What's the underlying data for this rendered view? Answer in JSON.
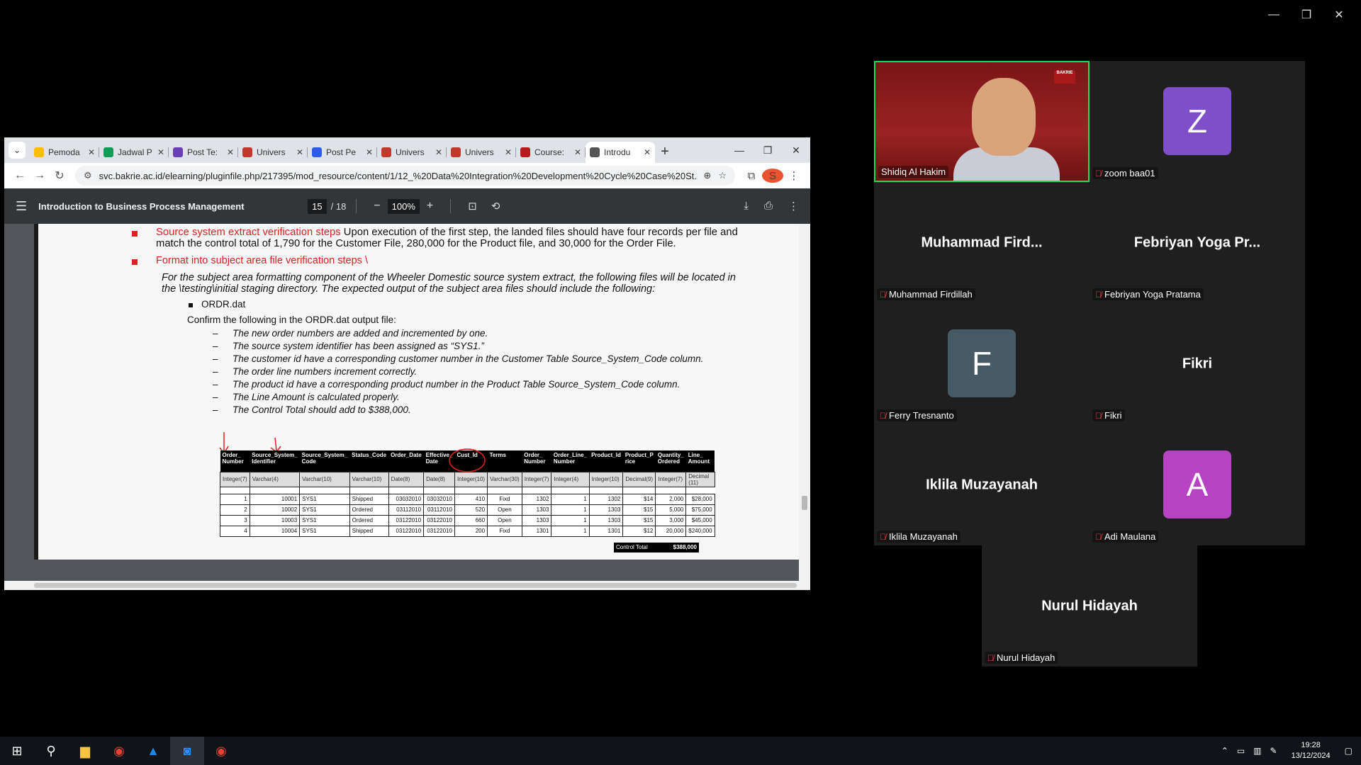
{
  "window_controls": {
    "minimize": "—",
    "restore": "❐",
    "close": "✕"
  },
  "browser": {
    "tab_list": "⌄",
    "tabs": [
      {
        "label": "Pemoda",
        "color": "#fbbc04"
      },
      {
        "label": "Jadwal P",
        "color": "#0f9d58"
      },
      {
        "label": "Post Te:",
        "color": "#6a3fb5"
      },
      {
        "label": "Univers",
        "color": "#c0392b"
      },
      {
        "label": "Post Pe",
        "color": "#2d5be3"
      },
      {
        "label": "Univers",
        "color": "#c0392b"
      },
      {
        "label": "Univers",
        "color": "#c0392b"
      },
      {
        "label": "Course:",
        "color": "#b71c1c"
      },
      {
        "label": "Introdu",
        "color": "#555555"
      }
    ],
    "new_tab": "+",
    "url": "svc.bakrie.ac.id/elearning/pluginfile.php/217395/mod_resource/content/1/12_%20Data%20Integration%20Development%20Cycle%20Case%20St..."
  },
  "pdf": {
    "title": "Introduction to Business Process Management",
    "page_current": "15",
    "page_total": "/ 18",
    "zoom": "100%",
    "content": {
      "b1_red": "Source system extract verification steps",
      "b1_text": " Upon execution of the first step, the landed files should have four records per file and",
      "b1_line2": "match the control total of 1,790 for the Customer File, 280,000 for the Product file, and 30,000 for the Order File.",
      "b2_red": "Format into subject area file verification steps \\",
      "p1": "For the subject area formatting component of the Wheeler Domestic source system extract, the following files will be located in",
      "p2": "the \\testing\\initial staging directory. The expected output of the subject area files should include the following:",
      "file": "ORDR.dat",
      "confirm": "Confirm the following in the ORDR.dat output file:",
      "checks": [
        "The new order numbers are added and incremented by one.",
        "The source system identifier has been assigned as “SYS1.”",
        "The customer id have a corresponding customer number in the Customer Table Source_System_Code column.",
        "The order line numbers increment correctly.",
        "The product id have a corresponding product number in the Product Table Source_System_Code column.",
        "The Line Amount is calculated properly.",
        "The Control Total should add to $388,000."
      ],
      "table": {
        "headers": [
          [
            "Order_",
            "Number"
          ],
          [
            "Source_System_",
            "Identifier"
          ],
          [
            "Source_System_",
            "Code"
          ],
          [
            "Status_Code",
            ""
          ],
          [
            "Order_Date",
            ""
          ],
          [
            "Effective_",
            "Date"
          ],
          [
            "Cust_Id",
            ""
          ],
          [
            "Terms",
            ""
          ],
          [
            "Order_",
            "Number"
          ],
          [
            "Order_Line_",
            "Number"
          ],
          [
            "Product_Id",
            ""
          ],
          [
            "Product_P",
            "rice"
          ],
          [
            "Quantity_",
            "Ordered"
          ],
          [
            "Line_",
            "Amount"
          ]
        ],
        "types": [
          "Integer(7)",
          "Varchar(4)",
          "Varchar(10)",
          "Varchar(10)",
          "Date(8)",
          "Date(8)",
          "Integer(10)",
          "Varchar(30)",
          "Integer(7)",
          "Integer(4)",
          "Integer(10)",
          "Decimal(9)",
          "Integer(7)",
          "Decimal (11)"
        ],
        "rows": [
          [
            "1",
            "10001",
            "SYS1",
            "Shipped",
            "03032010",
            "03032010",
            "410",
            "Fixd",
            "1302",
            "1",
            "1302",
            "$14",
            "2,000",
            "$28,000"
          ],
          [
            "2",
            "10002",
            "SYS1",
            "Ordered",
            "03112010",
            "03112010",
            "520",
            "Open",
            "1303",
            "1",
            "1303",
            "$15",
            "5,000",
            "$75,000"
          ],
          [
            "3",
            "10003",
            "SYS1",
            "Ordered",
            "03122010",
            "03122010",
            "660",
            "Open",
            "1303",
            "1",
            "1303",
            "$15",
            "3,000",
            "$45,000"
          ],
          [
            "4",
            "10004",
            "SYS1",
            "Shipped",
            "03122010",
            "03122010",
            "200",
            "Fixd",
            "1301",
            "1",
            "1301",
            "$12",
            "20,000",
            "$240,000"
          ]
        ],
        "control_total_label": "Control Total",
        "control_total_value": "$388,000"
      }
    }
  },
  "zoom": {
    "participants": [
      {
        "name": "Shidiq Al Hakim",
        "label": "Shidiq Al Hakim",
        "type": "video",
        "muted": false
      },
      {
        "name": "zoom baa01",
        "label": "zoom baa01",
        "type": "initial",
        "initial": "Z",
        "color": "#7e4fc9",
        "muted": true
      },
      {
        "name": "Muhammad  Fird...",
        "label": "Muhammad Firdillah",
        "type": "name",
        "muted": true
      },
      {
        "name": "Febriyan Yoga Pr...",
        "label": "Febriyan Yoga Pratama",
        "type": "name",
        "muted": true
      },
      {
        "name": "Ferry Tresnanto",
        "label": "Ferry Tresnanto",
        "type": "initial",
        "initial": "F",
        "color": "#455a64",
        "muted": true
      },
      {
        "name": "Fikri",
        "label": "Fikri",
        "type": "name",
        "muted": true
      },
      {
        "name": "Iklila Muzayanah",
        "label": "Iklila Muzayanah",
        "type": "name",
        "muted": true
      },
      {
        "name": "Adi Maulana",
        "label": "Adi Maulana",
        "type": "initial",
        "initial": "A",
        "color": "#b543c2",
        "muted": true
      },
      {
        "name": "Nurul Hidayah",
        "label": "Nurul Hidayah",
        "type": "name",
        "muted": true
      }
    ],
    "logo_text": "BAKRIE"
  },
  "taskbar": {
    "time": "19:28",
    "date": "13/12/2024"
  }
}
